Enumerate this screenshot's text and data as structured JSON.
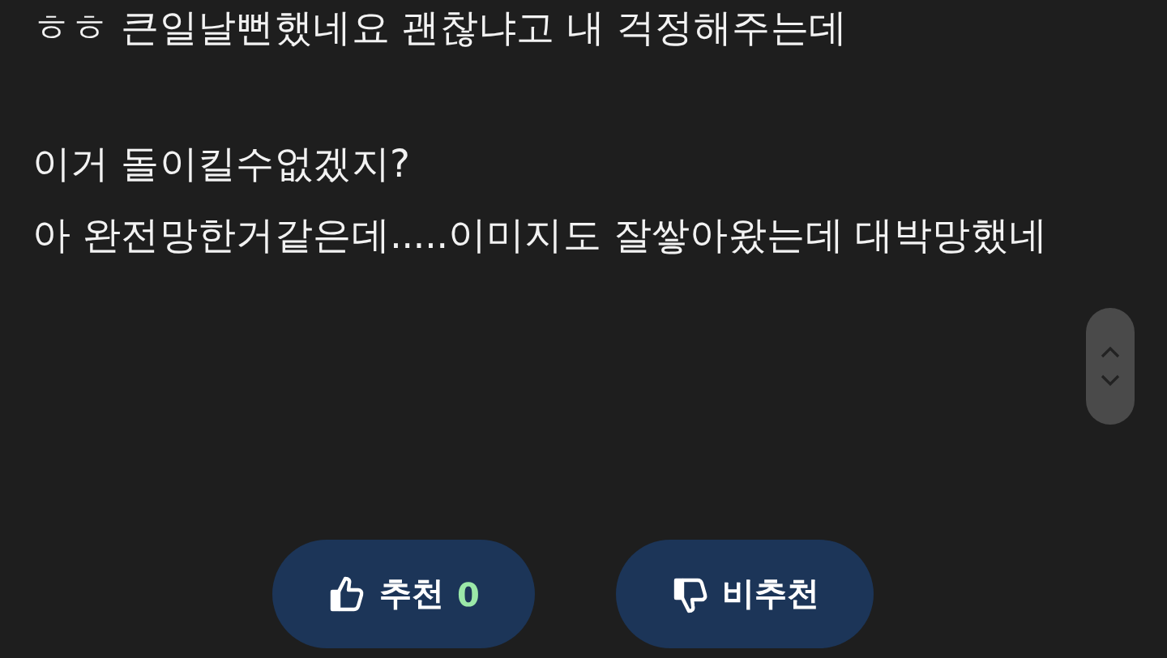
{
  "post": {
    "paragraphs": [
      [
        "ㅎㅎ 큰일날뻔했네요 괜찮냐고 내 걱정해주는데"
      ],
      [
        "이거 돌이킬수없겠지?",
        "아 완전망한거같은데.....이미지도 잘쌓아왔는데 대박망했네"
      ]
    ]
  },
  "vote": {
    "like": {
      "label": "추천",
      "count": "0"
    },
    "dislike": {
      "label": "비추천"
    }
  }
}
